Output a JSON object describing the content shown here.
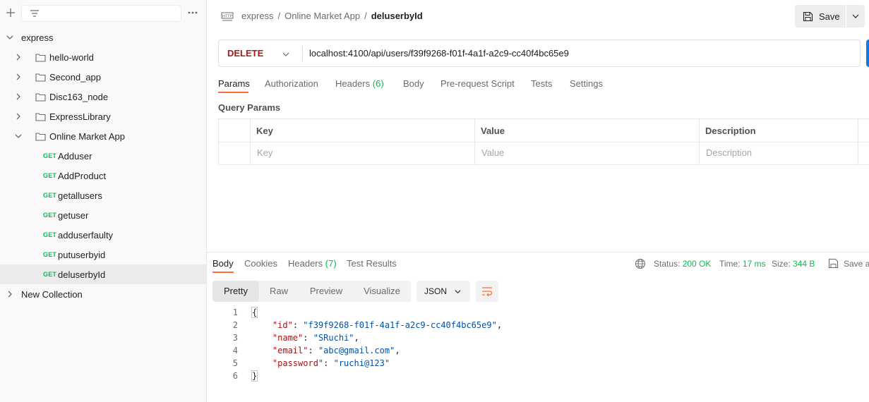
{
  "sidebar": {
    "root_collection": "express",
    "folders": [
      "hello-world",
      "Second_app",
      "Disc163_node",
      "ExpressLibrary",
      "Online Market App"
    ],
    "requests": [
      {
        "method": "GET",
        "name": "Adduser"
      },
      {
        "method": "GET",
        "name": "AddProduct"
      },
      {
        "method": "GET",
        "name": "getallusers"
      },
      {
        "method": "GET",
        "name": "getuser"
      },
      {
        "method": "GET",
        "name": "adduserfaulty"
      },
      {
        "method": "GET",
        "name": "putuserbyid"
      },
      {
        "method": "GET",
        "name": "deluserbyId"
      }
    ],
    "new_collection": "New Collection"
  },
  "header": {
    "breadcrumb": [
      "express",
      "Online Market App",
      "deluserbyId"
    ],
    "separator": "/",
    "save_label": "Save"
  },
  "request": {
    "method": "DELETE",
    "url": "localhost:4100/api/users/f39f9268-f01f-4a1f-a2c9-cc40f4bc65e9",
    "tabs": [
      "Params",
      "Authorization",
      "Headers",
      "Body",
      "Pre-request Script",
      "Tests",
      "Settings"
    ],
    "headers_count": "(6)",
    "query_params_title": "Query Params",
    "table": {
      "headers": [
        "Key",
        "Value",
        "Description"
      ],
      "placeholders": [
        "Key",
        "Value",
        "Description"
      ]
    }
  },
  "response": {
    "tabs": [
      "Body",
      "Cookies",
      "Headers",
      "Test Results"
    ],
    "headers_count": "(7)",
    "status_label": "Status:",
    "status": "200 OK",
    "time_label": "Time:",
    "time": "17 ms",
    "size_label": "Size:",
    "size": "344 B",
    "save_as": "Save a",
    "formats": [
      "Pretty",
      "Raw",
      "Preview",
      "Visualize"
    ],
    "language": "JSON",
    "lines": [
      "1",
      "2",
      "3",
      "4",
      "5",
      "6"
    ],
    "body": {
      "id_key": "\"id\"",
      "id_val": "\"f39f9268-f01f-4a1f-a2c9-cc40f4bc65e9\"",
      "name_key": "\"name\"",
      "name_val": "\"SRuchi\"",
      "email_key": "\"email\"",
      "email_val": "\"abc@gmail.com\"",
      "password_key": "\"password\"",
      "password_val": "\"ruchi@123\"",
      "open_brace": "{",
      "close_brace": "}"
    }
  },
  "colors": {
    "accent": "#ff6c37",
    "get": "#0cbb52",
    "delete": "#a61b1b",
    "status_ok": "#0cbb52"
  }
}
